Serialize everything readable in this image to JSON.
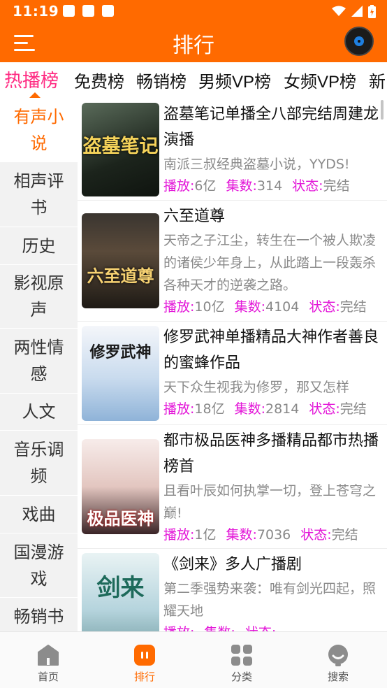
{
  "status": {
    "time": "11:19"
  },
  "header": {
    "title": "排行"
  },
  "tabs": [
    {
      "label": "热播榜",
      "active": true
    },
    {
      "label": "免费榜"
    },
    {
      "label": "畅销榜"
    },
    {
      "label": "男频VP榜"
    },
    {
      "label": "女频VP榜"
    },
    {
      "label": "新"
    }
  ],
  "sidebar": {
    "items": [
      {
        "label": "有声小说",
        "active": true
      },
      {
        "label": "相声评书"
      },
      {
        "label": "历史"
      },
      {
        "label": "影视原声"
      },
      {
        "label": "两性情感"
      },
      {
        "label": "人文"
      },
      {
        "label": "音乐调频"
      },
      {
        "label": "戏曲"
      },
      {
        "label": "国漫游戏"
      },
      {
        "label": "畅销书"
      }
    ]
  },
  "list": {
    "labels": {
      "plays": "播放:",
      "episodes": "集数:",
      "status": "状态:"
    },
    "items": [
      {
        "title": "盗墓笔记单播全八部完结周建龙演播",
        "desc": "南派三叔经典盗墓小说，YYDS!",
        "plays": "6亿",
        "episodes": "314",
        "status": "完结",
        "cover_text": "盗墓笔记",
        "cover_color": "#1f2a20"
      },
      {
        "title": "六至道尊",
        "desc": "天帝之子江尘，转生在一个被人欺凌的诸侯少年身上，从此踏上一段轰杀各种天才的逆袭之路。",
        "plays": "10亿",
        "episodes": "4104",
        "status": "完结",
        "cover_text": "六至道尊",
        "cover_color": "#2b2620"
      },
      {
        "title": "修罗武神单播精品大神作者善良的蜜蜂作品",
        "desc": "天下众生视我为修罗，那又怎样",
        "plays": "18亿",
        "episodes": "2814",
        "status": "完结",
        "cover_text": "修罗武神",
        "cover_color": "#dfe9f4"
      },
      {
        "title": "都市极品医神多播精品都市热播榜首",
        "desc": "且看叶辰如何执掌一切，登上苍穹之巅!",
        "plays": "1亿",
        "episodes": "7036",
        "status": "完结",
        "cover_text": "极品医神",
        "cover_color": "#f2e6e3"
      },
      {
        "title": "《剑来》多人广播剧",
        "desc": "第二季强势来袭：唯有剑光四起，照耀天地",
        "plays": "",
        "episodes": "",
        "status": "",
        "cover_text": "剑来",
        "cover_color": "#cfe3ea"
      }
    ]
  },
  "bottom_nav": [
    {
      "label": "首页",
      "icon": "home-icon"
    },
    {
      "label": "排行",
      "icon": "ranking-icon",
      "active": true
    },
    {
      "label": "分类",
      "icon": "category-icon"
    },
    {
      "label": "搜索",
      "icon": "search-icon"
    }
  ],
  "colors": {
    "accent": "#ff6a00",
    "tab_active": "#ff2a82",
    "meta_key": "#e316d8"
  }
}
